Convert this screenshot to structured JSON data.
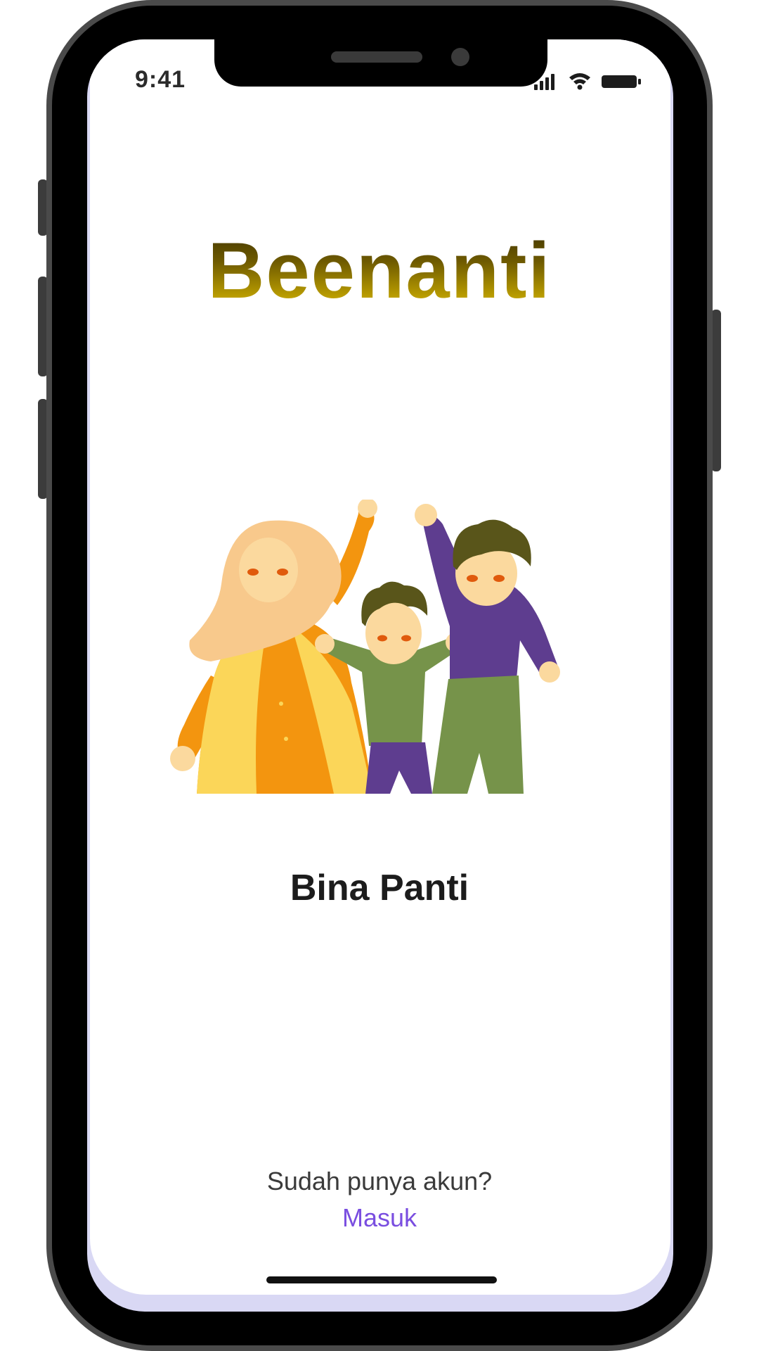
{
  "status_bar": {
    "time": "9:41",
    "icons": [
      "cellular-signal-icon",
      "wifi-icon",
      "battery-icon"
    ]
  },
  "app": {
    "title": "Beenanti"
  },
  "illustration": {
    "name": "family-illustration",
    "colors": {
      "mother_hijab": "#f8c98c",
      "mother_robe": "#f3950f",
      "mother_overcoat": "#fbd659",
      "boy_shirt": "#76934a",
      "boy_pants": "#5e3d8f",
      "man_shirt": "#5e3d8f",
      "man_pants": "#76934a",
      "hair": "#59551a",
      "skin": "#fbd99e"
    }
  },
  "role": {
    "label": "Bina Panti"
  },
  "footer": {
    "prompt": "Sudah punya akun?",
    "login_label": "Masuk"
  },
  "colors": {
    "link": "#7a4ee0",
    "title_gradient_top": "#3b3000",
    "title_gradient_bottom": "#e4c200",
    "screen_edge": "#d9d8f4"
  }
}
